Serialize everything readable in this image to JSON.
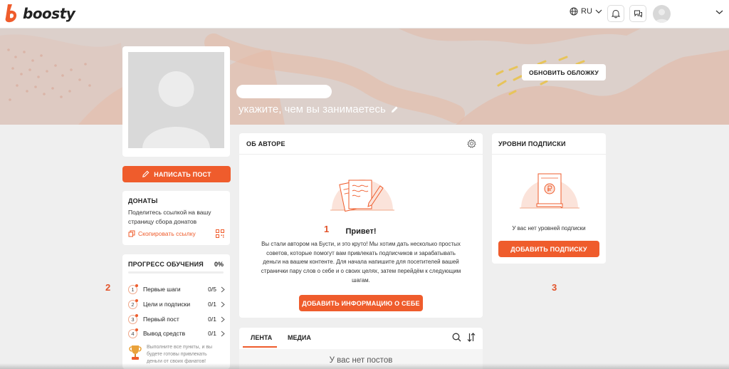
{
  "header": {
    "brand": "boosty",
    "language": "RU"
  },
  "cover": {
    "update_cover_label": "ОБНОВИТЬ ОБЛОЖКУ",
    "occupation_placeholder": "укажите, чем вы занимаетесь"
  },
  "sidebar": {
    "write_post_label": "НАПИСАТЬ ПОСТ",
    "donats": {
      "title": "ДОНАТЫ",
      "text": "Поделитесь ссылкой на вашу страницу сбора донатов",
      "copy_link_label": "Скопировать ссылку"
    },
    "progress": {
      "title": "ПРОГРЕСС ОБУЧЕНИЯ",
      "percent_label": "0%",
      "percent": 0,
      "steps": [
        {
          "num": "1",
          "label": "Первые шаги",
          "count": "0/5"
        },
        {
          "num": "2",
          "label": "Цели и подписки",
          "count": "0/1"
        },
        {
          "num": "3",
          "label": "Первый пост",
          "count": "0/1"
        },
        {
          "num": "4",
          "label": "Вывод средств",
          "count": "0/1"
        }
      ],
      "hint": "Выполните все пункты, и вы будете готовы привлекать деньги от своих фанатов!"
    }
  },
  "about": {
    "title": "ОБ АВТОРЕ",
    "hello": "Привет!",
    "text": "Вы стали автором на Бусти, и это круто! Мы хотим дать несколько простых советов, которые помогут вам привлекать подписчиков и зарабатывать деньги на вашем контенте. Для начала напишите для посетителей вашей странички пару слов о себе и о своих целях, затем перейдём к следующим шагам.",
    "button_label": "ДОБАВИТЬ ИНФОРМАЦИЮ О СЕБЕ"
  },
  "feed": {
    "tabs": [
      {
        "label": "ЛЕНТА",
        "active": true
      },
      {
        "label": "МЕДИА",
        "active": false
      }
    ],
    "empty_text": "У вас нет постов"
  },
  "levels": {
    "title": "УРОВНИ ПОДПИСКИ",
    "empty_text": "У вас нет уровней подписки",
    "button_label": "ДОБАВИТЬ ПОДПИСКУ"
  },
  "annotations": [
    "1",
    "2",
    "3"
  ],
  "colors": {
    "accent": "#ef5c2c",
    "cover": "#dcd0cb",
    "cover_stroke": "#e6b9a6",
    "cover_dash": "#e7c45a",
    "illustration_bg": "#fbe3da"
  },
  "icons": {
    "globe": "globe-icon",
    "bell": "bell-icon",
    "chat": "chat-icon",
    "pencil": "pencil-icon",
    "copy": "copy-icon",
    "qr": "qr-code-icon",
    "gear": "gear-icon",
    "search": "search-icon",
    "sort": "sort-icon",
    "trophy": "trophy-icon",
    "chevron": "chevron-right-icon"
  }
}
